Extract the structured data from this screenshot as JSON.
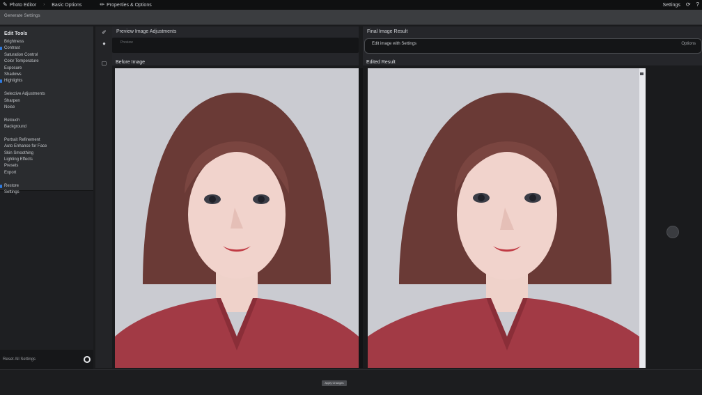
{
  "topbar": {
    "brand": "Photo Editor",
    "crumb": "Basic Options",
    "tools": "Properties & Options",
    "right_label": "Settings"
  },
  "ribbon": {
    "subtitle": "Generate Settings"
  },
  "sidebar": {
    "title": "Edit Tools",
    "items": [
      {
        "label": "Brightness",
        "accent": false
      },
      {
        "label": "Contrast",
        "accent": true
      },
      {
        "label": "Saturation Control",
        "accent": false
      },
      {
        "label": "Color Temperature",
        "accent": false
      },
      {
        "label": "Exposure",
        "accent": false
      },
      {
        "label": "Shadows",
        "accent": false
      },
      {
        "label": "Highlights",
        "accent": true
      },
      {
        "label": "",
        "accent": false
      },
      {
        "label": "Selective Adjustments",
        "accent": false
      },
      {
        "label": "Sharpen",
        "accent": false
      },
      {
        "label": "Noise",
        "accent": false
      },
      {
        "label": "",
        "accent": false
      },
      {
        "label": "Retouch",
        "accent": false
      },
      {
        "label": "Background",
        "accent": false
      },
      {
        "label": "",
        "accent": false
      },
      {
        "label": "Portrait Refinement",
        "accent": false
      },
      {
        "label": "Auto Enhance for Face",
        "accent": false
      },
      {
        "label": "Skin Smoothing",
        "accent": false
      },
      {
        "label": "Lighting Effects",
        "accent": false
      },
      {
        "label": "Presets",
        "accent": false
      },
      {
        "label": "Export",
        "accent": false
      },
      {
        "label": "",
        "accent": false
      },
      {
        "label": "Restore",
        "accent": true
      },
      {
        "label": "Settings",
        "accent": false
      }
    ],
    "bottom_label": "Reset All Settings"
  },
  "left_panel": {
    "title": "Preview Image Adjustments",
    "placeholder": "Preview"
  },
  "right_panel": {
    "title": "Final Image Result",
    "field_value": "Edit image with Settings",
    "field_trail": "Options"
  },
  "viewers": {
    "left_label": "Before Image",
    "right_label": "Edited Result"
  },
  "bottom": {
    "button_label": "Apply Changes"
  },
  "colors": {
    "accent": "#2f7be0",
    "sweater": "#a23a45",
    "hair": "#6a3a36",
    "skin": "#f1d3cc",
    "backdrop": "#cacbd1"
  }
}
